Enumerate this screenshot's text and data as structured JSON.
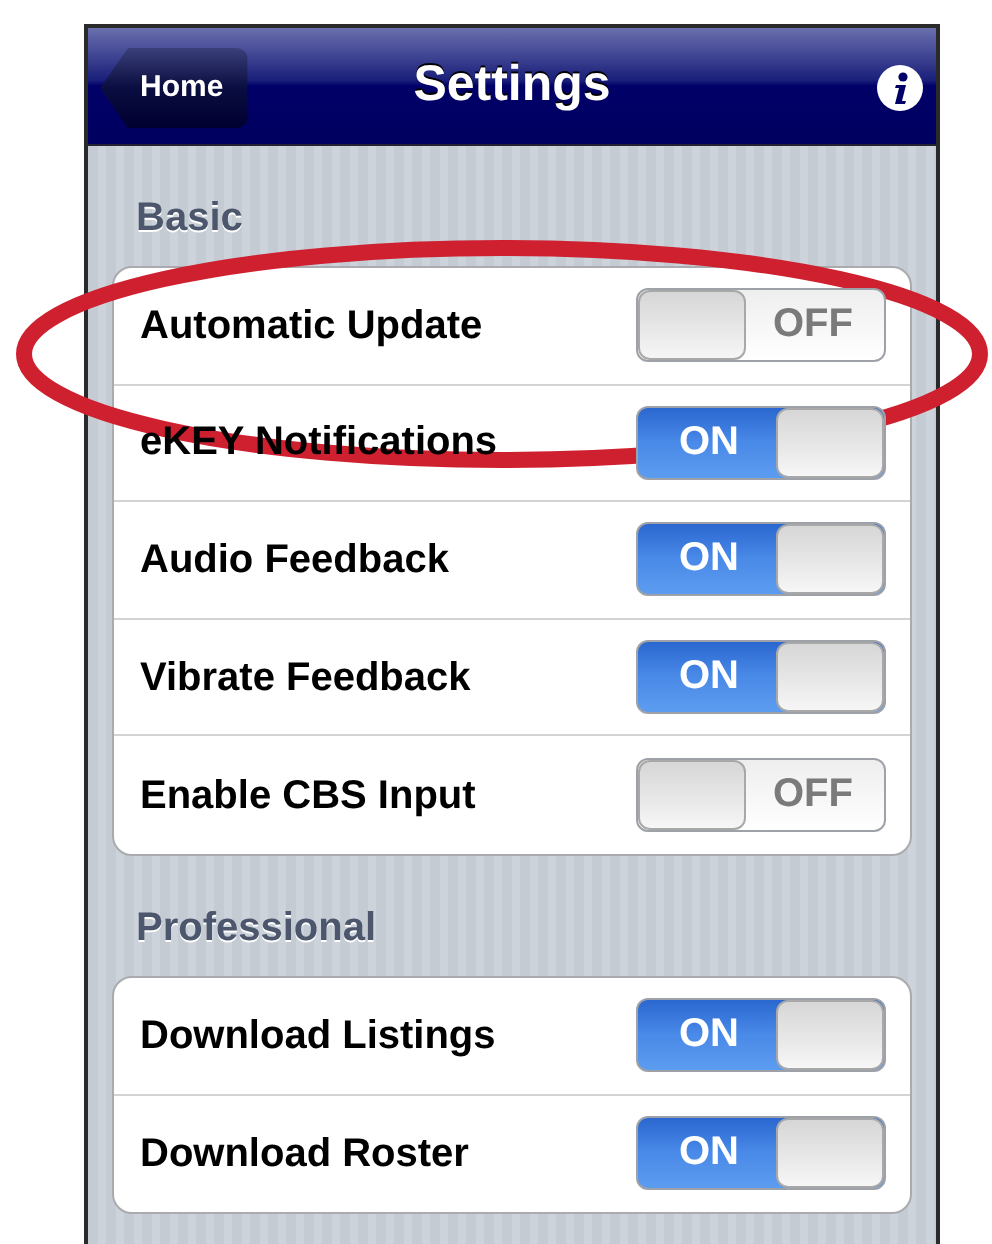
{
  "nav_bar": {
    "back_button": "Home",
    "title": "Settings"
  },
  "sections": [
    {
      "header": "Basic",
      "rows": [
        {
          "label": "Automatic Update",
          "on": false,
          "switch_text": "OFF"
        },
        {
          "label": "eKEY Notifications",
          "on": true,
          "switch_text": "ON"
        },
        {
          "label": "Audio Feedback",
          "on": true,
          "switch_text": "ON"
        },
        {
          "label": "Vibrate Feedback",
          "on": true,
          "switch_text": "ON"
        },
        {
          "label": "Enable CBS Input",
          "on": false,
          "switch_text": "OFF"
        }
      ]
    },
    {
      "header": "Professional",
      "rows": [
        {
          "label": "Download Listings",
          "on": true,
          "switch_text": "ON"
        },
        {
          "label": "Download Roster",
          "on": true,
          "switch_text": "ON"
        }
      ]
    }
  ]
}
